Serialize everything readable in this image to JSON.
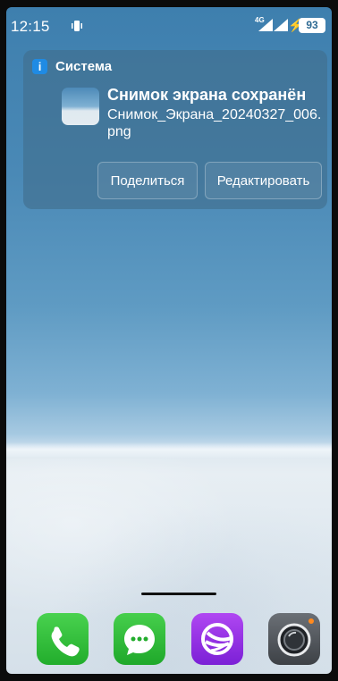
{
  "status_bar": {
    "time": "12:15",
    "network_label": "4G",
    "battery": "93"
  },
  "notification": {
    "app_name": "Система",
    "title": "Снимок экрана сохранён",
    "body": "Снимок_Экрана_20240327_006.png",
    "actions": {
      "share": "Поделиться",
      "edit": "Редактировать"
    }
  },
  "dock": {
    "apps": [
      "phone-icon",
      "messages-icon",
      "browser-icon",
      "camera-icon"
    ]
  },
  "colors": {
    "notification_bg": "#406e8c",
    "app_icon_blue": "#1f8be4",
    "phone_green": "#22ad2c",
    "browser_purple": "#7b20d6",
    "camera_gray": "#3d4146"
  }
}
